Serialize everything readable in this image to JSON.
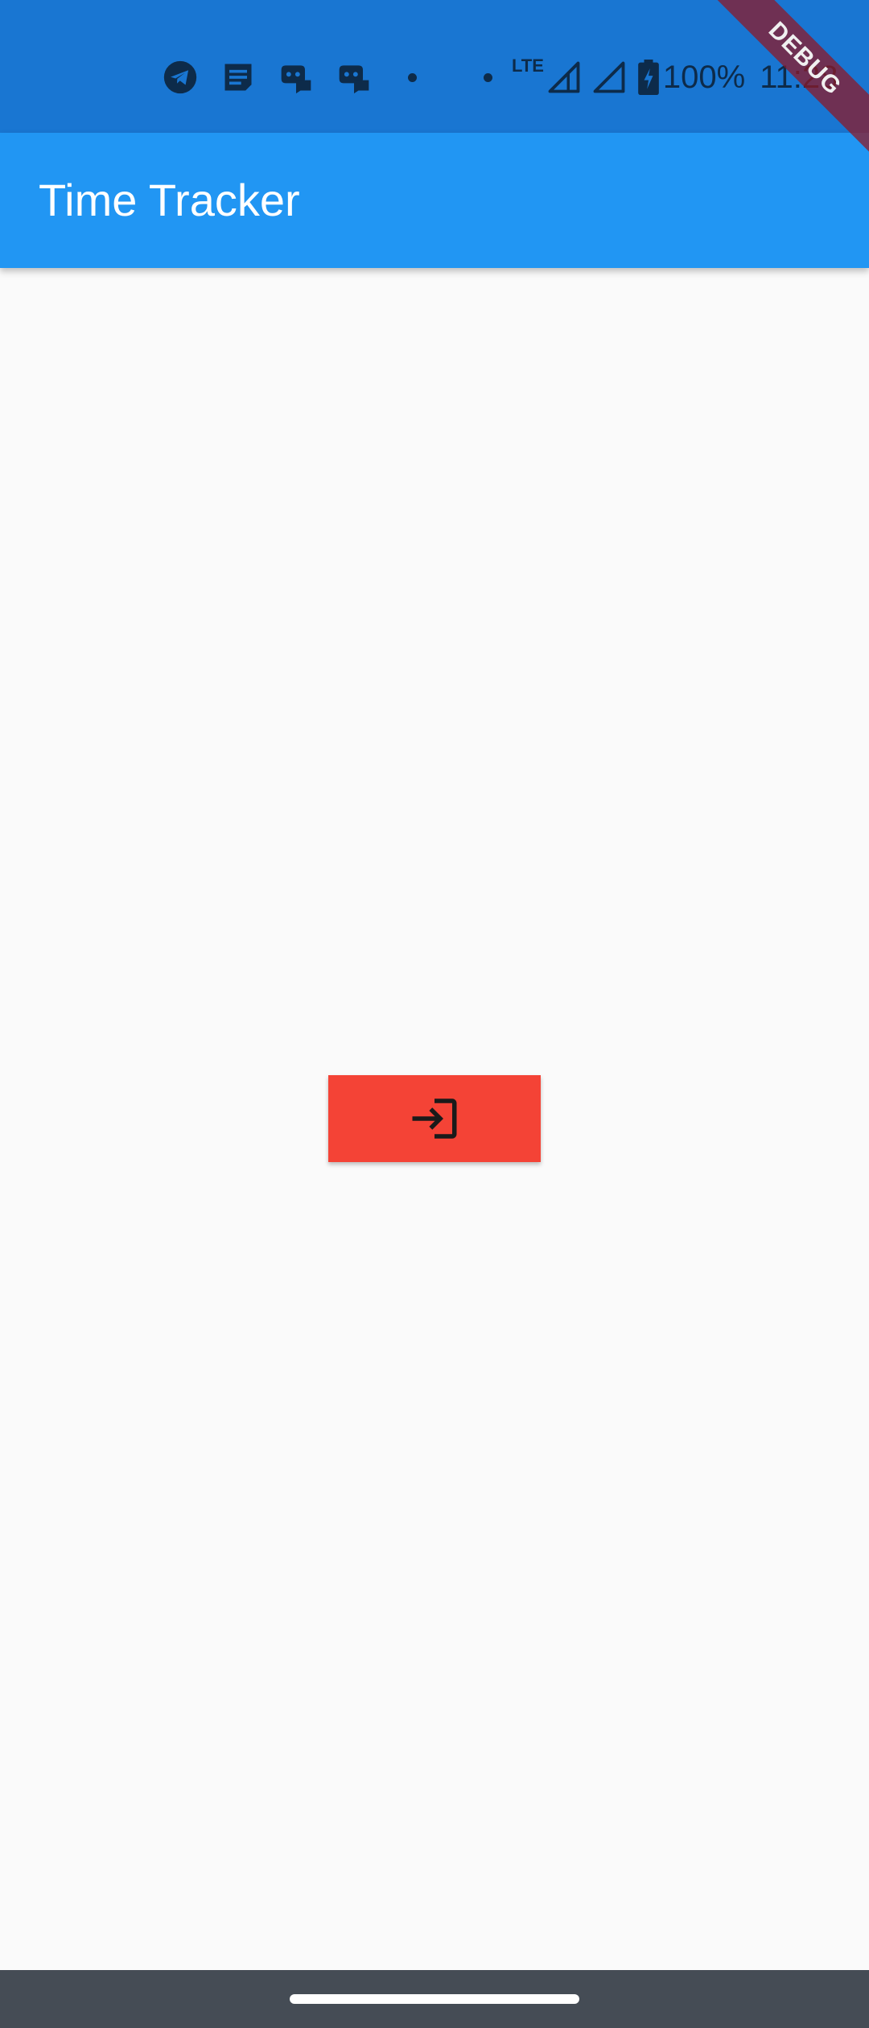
{
  "status_bar": {
    "color": "#1976d2",
    "notification_icons": [
      "telegram-icon",
      "notes-icon",
      "discord-icon",
      "discord-icon",
      "dot-icon"
    ],
    "network_label": "LTE",
    "battery_text": "100%",
    "time": "11:28"
  },
  "debug_banner": {
    "label": "DEBUG"
  },
  "app_bar": {
    "title": "Time Tracker",
    "color": "#2196f3"
  },
  "login": {
    "icon": "login-icon",
    "color": "#f44336"
  }
}
